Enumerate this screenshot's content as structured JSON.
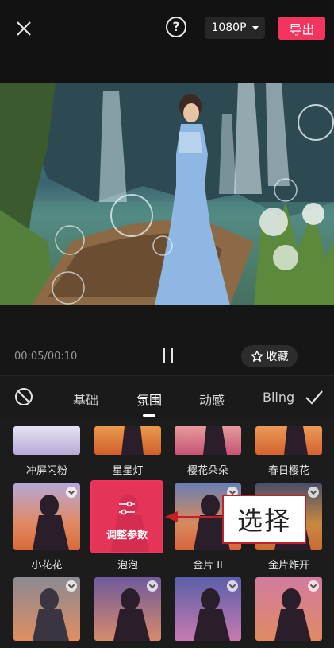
{
  "topbar": {
    "close_icon": "close-icon",
    "help_icon_text": "?",
    "resolution": "1080P",
    "export_label": "导出"
  },
  "player": {
    "timecode": "00:05/00:10",
    "favorite_label": "收藏",
    "pause_icon": "pause-icon",
    "favorite_icon": "star-icon"
  },
  "categories": {
    "tabs": [
      "基础",
      "氛围",
      "动感",
      "Bling"
    ],
    "active": "氛围",
    "no_effect_icon": "ban-icon",
    "confirm_icon": "check-icon"
  },
  "effects": {
    "row1": [
      "冲屏闪粉",
      "星星灯",
      "樱花朵朵",
      "春日樱花"
    ],
    "row2": [
      "小花花",
      "泡泡",
      "金片 II",
      "金片炸开"
    ],
    "selected": "泡泡",
    "selected_overlay_label": "调整参数"
  },
  "annotation": {
    "callout_text": "选择",
    "accent": "#c2202a"
  },
  "colors": {
    "accent": "#f3345e",
    "background": "#141414"
  }
}
